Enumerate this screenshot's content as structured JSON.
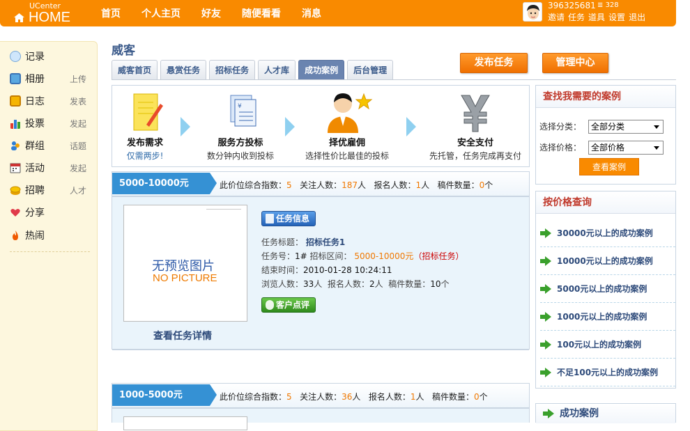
{
  "header": {
    "logo_line1": "UCenter",
    "logo_line2": "HOME",
    "nav": [
      "首页",
      "个人主页",
      "好友",
      "随便看看",
      "消息"
    ],
    "uid": "396325681",
    "credit": "328",
    "user_links": [
      "邀请",
      "任务",
      "道具",
      "设置",
      "退出"
    ],
    "brand_color": "#f98a00"
  },
  "sidebar": {
    "items": [
      {
        "label": "记录",
        "extra": "",
        "icon": "chat-bubble-icon"
      },
      {
        "label": "相册",
        "extra": "上传",
        "icon": "photo-icon"
      },
      {
        "label": "日志",
        "extra": "发表",
        "icon": "notebook-icon"
      },
      {
        "label": "投票",
        "extra": "发起",
        "icon": "bar-chart-icon"
      },
      {
        "label": "群组",
        "extra": "话题",
        "icon": "group-icon"
      },
      {
        "label": "活动",
        "extra": "发起",
        "icon": "calendar-icon"
      },
      {
        "label": "招聘",
        "extra": "人才",
        "icon": "coins-icon"
      },
      {
        "label": "分享",
        "extra": "",
        "icon": "heart-share-icon"
      },
      {
        "label": "热闹",
        "extra": "",
        "icon": "flame-icon"
      }
    ]
  },
  "page": {
    "title": "威客",
    "tabs": [
      "威客首页",
      "悬赏任务",
      "招标任务",
      "人才库",
      "成功案例",
      "后台管理"
    ],
    "active_tab": "成功案例",
    "publish_button": "发布任务",
    "manage_button": "管理中心"
  },
  "steps": [
    {
      "title": "发布需求",
      "sub": "仅需两步!",
      "icon": "notepad-icon"
    },
    {
      "title": "服务方投标",
      "sub": "数分钟内收到投标",
      "icon": "documents-icon"
    },
    {
      "title": "择优雇佣",
      "sub": "选择性价比最佳的投标",
      "icon": "person-star-icon"
    },
    {
      "title": "安全支付",
      "sub": "先托管，任务完成再支付",
      "icon": "yen-icon"
    }
  ],
  "sections": [
    {
      "range": "5000-10000元",
      "stats_label1": "此价位综合指数：",
      "index": "5",
      "stats_label2": "关注人数：",
      "followers": "187",
      "unit_ren": "人",
      "stats_label3": "报名人数：",
      "signups": "1",
      "stats_label4": "稿件数量：",
      "drafts": "0",
      "unit_ge": "个",
      "task": {
        "no_preview_cn": "无预览图片",
        "no_preview_en": "NO PICTURE",
        "detail_link": "查看任务详情",
        "info_button": "任务信息",
        "title_label": "任务标题：",
        "title": "招标任务1",
        "no_label": "任务号：",
        "no": "1#",
        "range_label": "招标区间：",
        "range": "5000-10000元",
        "type_open": "（",
        "type": "招标任务",
        "type_close": "）",
        "end_label": "结束时间：",
        "end_time": "2010-01-28 10:24:11",
        "views_label": "浏览人数：",
        "views": "33",
        "views_unit": "人",
        "signups_label": "报名人数：",
        "signups": "2",
        "signups_unit": "人",
        "drafts_label": "稿件数量：",
        "drafts": "10",
        "drafts_unit": "个",
        "comment_button": "客户点评"
      }
    },
    {
      "range": "1000-5000元",
      "stats_label1": "此价位综合指数：",
      "index": "5",
      "stats_label2": "关注人数：",
      "followers": "36",
      "unit_ren": "人",
      "stats_label3": "报名人数：",
      "signups": "1",
      "stats_label4": "稿件数量：",
      "drafts": "0",
      "unit_ge": "个"
    }
  ],
  "right": {
    "find_title": "查找我需要的案例",
    "category_label": "选择分类：",
    "category_value": "全部分类",
    "price_label": "选择价格：",
    "price_value": "全部价格",
    "view_button": "查看案例",
    "price_title": "按价格查询",
    "price_links": [
      "30000元以上的成功案例",
      "10000元以上的成功案例",
      "5000元以上的成功案例",
      "1000元以上的成功案例",
      "100元以上的成功案例",
      "不足100元以上的成功案例"
    ],
    "cases_title": "成功案例"
  }
}
